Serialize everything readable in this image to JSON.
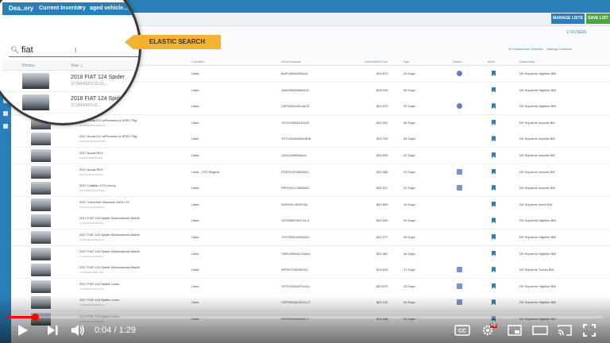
{
  "app": {
    "logo": "Dea..ery",
    "nav_inventory": "Current Inventory",
    "nav_aged": "aged vehicle...",
    "manage_lists": "MANAGE LISTS",
    "save_list": "SAVE LIST",
    "filters": "FILTERS",
    "dealerships_selected": "40 Dealerships Selected",
    "manage_columns": "Manage Columns"
  },
  "search": {
    "query": "fiat"
  },
  "callout": "ELASTIC SEARCH",
  "columns": {
    "photos": "Photos",
    "year": "Year",
    "condition": "Condition",
    "stock": "Stock Number",
    "price": "Advertised Price",
    "age": "Age",
    "status": "Status",
    "mark": "Mark",
    "dealership": "Dealership"
  },
  "magnified_rows": [
    {
      "title": "2018 FIAT 124 Spider",
      "vin": "JC1NFAEK5J0130..."
    },
    {
      "title": "2018 FIAT 124 Spider Lusso",
      "vin": "JC1NFAEK5J0..."
    }
  ],
  "rows": [
    {
      "title": "2018 FIAT 124 Spider",
      "vin": "JC1NFAEK5J0130...",
      "cond": "Used",
      "stock": "BUP33630500A24",
      "price": "$24,579",
      "age": "43 Days",
      "status": "dot",
      "dealer": "DS Supreme Highline BW"
    },
    {
      "title": "2018 FIAT 124 Spider Lusso",
      "vin": "JC1NFAEK5J0...",
      "cond": "Used",
      "stock": "1N8330E6206A420",
      "price": "$28,199",
      "age": "59 Days",
      "status": "",
      "dealer": "DS Supreme Highline BW"
    },
    {
      "title": "2017 Alfa Romeo Giulia",
      "vin": "ZARFAEBN5H7532...",
      "cond": "Used",
      "stock": "C0P0430L0614A23",
      "price": "$24,979",
      "age": "37 Days",
      "status": "dot",
      "dealer": "DS Supreme Highline BW"
    },
    {
      "title": "2017 Acura ILX w/Premium A-SPEC Pkg",
      "vin": "19UDE2F80HA0028071",
      "cond": "Used",
      "stock": "Y9TC9280A014433",
      "price": "$22,001",
      "age": "56 Days",
      "status": "",
      "dealer": "DS Supreme Imports BW"
    },
    {
      "title": "2017 Acura ILX w/Premium A-SPEC Pkg",
      "vin": "19UDE2F81HA0029418",
      "cond": "Used",
      "stock": "Y9TC9433A0344018",
      "price": "$23,793",
      "age": "54 Days",
      "status": "",
      "dealer": "DS Supreme Imports BW"
    },
    {
      "title": "2017 Acura RDX",
      "vin": "5J8TB4H58HL004451",
      "cond": "Used",
      "stock": "1100C90553A441",
      "price": "$33,999",
      "age": "22 Days",
      "status": "",
      "dealer": "DS Supreme Imports BW"
    },
    {
      "title": "2017 Acura RDX",
      "vin": "5J8TB4H36HL009789",
      "cond": "Used - CPO Eligible",
      "stock": "PDRS10C0553A24",
      "price": "$32,088",
      "age": "22 Days",
      "status": "sq",
      "dealer": "DS Supreme Imports BW"
    },
    {
      "title": "2017 Cadillac XT5 Luxury",
      "vin": "1GYKNBRS8HZ150390",
      "cond": "Used",
      "stock": "PPRS10-C0055A42",
      "price": "$32,047",
      "age": "47 Days",
      "status": "sq",
      "dealer": "DS Supreme Imports BW"
    },
    {
      "title": "2017 Chevrolet Silverado 1500 LTZ",
      "vin": "3GCUKSEJ3HG349815",
      "cond": "Used",
      "stock": "GHP010-00S07A5",
      "price": "$47,899",
      "age": "19 Days",
      "status": "",
      "dealer": "DS Supreme North BW"
    },
    {
      "title": "2017 FIAT 124 Spider Elaborazione Abarth",
      "vin": "JC1NFAEK8H0110400",
      "cond": "Used",
      "stock": "Y9TGB557A0744-4",
      "price": "$22,530",
      "age": "92 Days",
      "status": "",
      "dealer": "DS Supreme Highline BW"
    },
    {
      "title": "2017 FIAT 124 Spider Elaborazione Abarth",
      "vin": "JC1NFAEK4H0112246",
      "cond": "Used",
      "stock": "Y9TC6957A034A24",
      "price": "$22,377",
      "age": "99 Days",
      "status": "",
      "dealer": "DS Supreme Highline BW"
    },
    {
      "title": "2017 FIAT 124 Spider Elaborazione Abarth",
      "vin": "JC1NFAEK0H0118950",
      "cond": "Used",
      "stock": "Y9RC9080A1744A3",
      "price": "$22,362",
      "age": "34 Days",
      "status": "",
      "dealer": "DS Supreme Highline BW"
    },
    {
      "title": "2017 FIAT 124 Spider Elaborazione Abarth",
      "vin": "JC1NFAEK3H0117402",
      "cond": "Used",
      "stock": "IHP9S7C8S057A3",
      "price": "$19,933",
      "age": "17 Days",
      "status": "sq",
      "dealer": "DS Supreme Trucks BW"
    },
    {
      "title": "2017 FIAT 124 Spider Lusso",
      "vin": "JC1NFAEK1H0104473",
      "cond": "Used",
      "stock": "Y9TC9430A07A414",
      "price": "$23,579",
      "age": "43 Days",
      "status": "sq",
      "dealer": "DS Supreme Highline BW"
    },
    {
      "title": "2017 FIAT 124 Spider Lusso",
      "vin": "JC1NFAEK6H0108217",
      "cond": "Used",
      "stock": "C0P2940QL0044-17",
      "price": "$20,131",
      "age": "51 Days",
      "status": "sq",
      "dealer": "DS Supreme Highline BW"
    },
    {
      "title": "2017 FIAT 124 Spider Lusso",
      "vin": "JC1NFAEK9H0110091",
      "cond": "Used",
      "stock": "GHP9S8-00S057-1",
      "price": "$21,448",
      "age": "81 Days",
      "status": "",
      "dealer": "DS Supreme Highline BW"
    }
  ],
  "video": {
    "time": "0:04 / 1:29",
    "progress": 0.045,
    "hd": "HD"
  }
}
